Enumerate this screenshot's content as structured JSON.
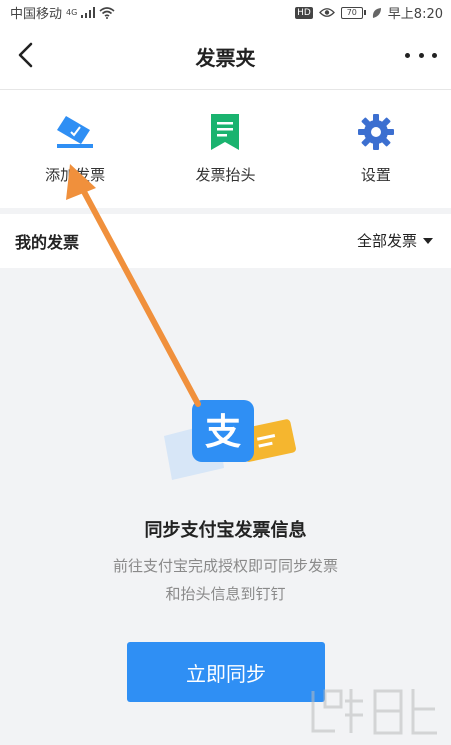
{
  "status_bar": {
    "carrier": "中国移动",
    "network_tag": "4G",
    "hd_badge": "HD",
    "battery_level": "70",
    "time": "早上8:20"
  },
  "nav": {
    "title": "发票夹"
  },
  "actions": [
    {
      "label": "添加发票",
      "icon": "add-invoice-icon",
      "color": "#2f8ff4"
    },
    {
      "label": "发票抬头",
      "icon": "invoice-header-icon",
      "color": "#1ab36f"
    },
    {
      "label": "设置",
      "icon": "gear-icon",
      "color": "#3c6fd0"
    }
  ],
  "section": {
    "title": "我的发票",
    "filter_label": "全部发票"
  },
  "empty_state": {
    "illustration_glyph": "支",
    "title": "同步支付宝发票信息",
    "desc_line1": "前往支付宝完成授权即可同步发票",
    "desc_line2": "和抬头信息到钉钉",
    "button_label": "立即同步"
  },
  "colors": {
    "accent": "#2f8ff4",
    "annotation": "#f0903c"
  }
}
